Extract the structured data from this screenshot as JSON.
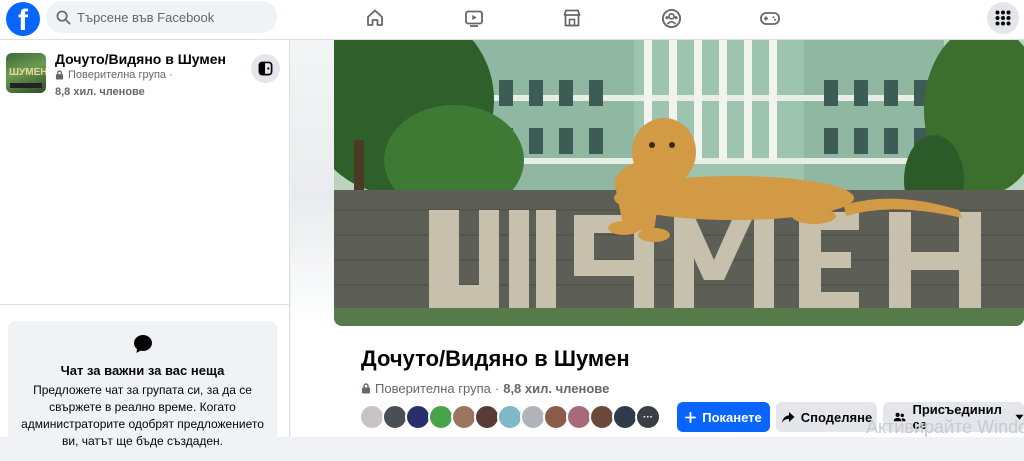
{
  "topbar": {
    "logo_letter": "f",
    "search_placeholder": "Търсене във Facebook",
    "nav_icons": [
      "home-icon",
      "video-icon",
      "marketplace-icon",
      "groups-icon",
      "gaming-icon"
    ],
    "menu_icon": "grid-menu-icon"
  },
  "sidebar": {
    "group": {
      "name": "Дочуто/Видяно в Шумен",
      "privacy": "Поверителна група ·",
      "members": "8,8 хил. членове"
    },
    "chat_card": {
      "title": "Чат за важни за вас неща",
      "description": "Предложете чат за групата си, за да се свържете в реално време. Когато администраторите одобрят предложението ви, чатът ще бъде създаден."
    }
  },
  "main": {
    "cover_text": "ШУМЕН",
    "group_title": "Дочуто/Видяно в Шумен",
    "privacy": "Поверителна група",
    "separator": "·",
    "members": "8,8 хил. членове",
    "avatar_count": 13,
    "buttons": {
      "invite": "Поканете",
      "share": "Споделяне",
      "joined": "Присъединил се"
    }
  },
  "watermark": "Активирайте Windows",
  "colors": {
    "brand_blue": "#0866ff",
    "secondary_button": "#e4e6eb",
    "text_secondary": "#65676b"
  }
}
